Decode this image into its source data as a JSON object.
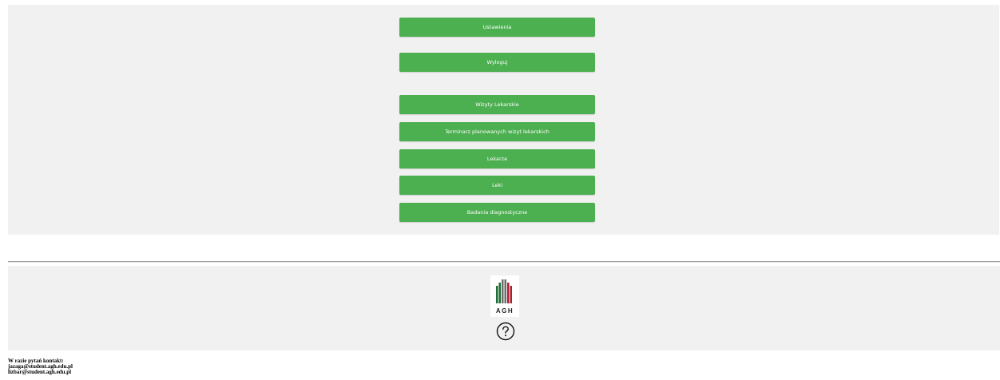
{
  "menu": {
    "settings_label": "Ustawienia",
    "logout_label": "Wyloguj",
    "items": [
      {
        "label": "Wizyty Lekarskie"
      },
      {
        "label": "Terminarz planowanych wizyt lekarskich"
      },
      {
        "label": "Lekarze"
      },
      {
        "label": "Leki"
      },
      {
        "label": "Badania diagnostyczne"
      }
    ]
  },
  "footer": {
    "logo_text": "AGH",
    "help_icon": "question-circle-icon",
    "contact_heading": "W razie pytań kontakt:",
    "contact_emails": [
      "jazaga@student.agh.edu.pl",
      "lizbar@student.agh.edu.pl"
    ]
  },
  "colors": {
    "button_green": "#4caf50",
    "panel_gray": "#f1f1f1",
    "logo_green": "#1e6b36",
    "logo_red": "#b01c2e",
    "logo_gray": "#6d6d6d"
  }
}
